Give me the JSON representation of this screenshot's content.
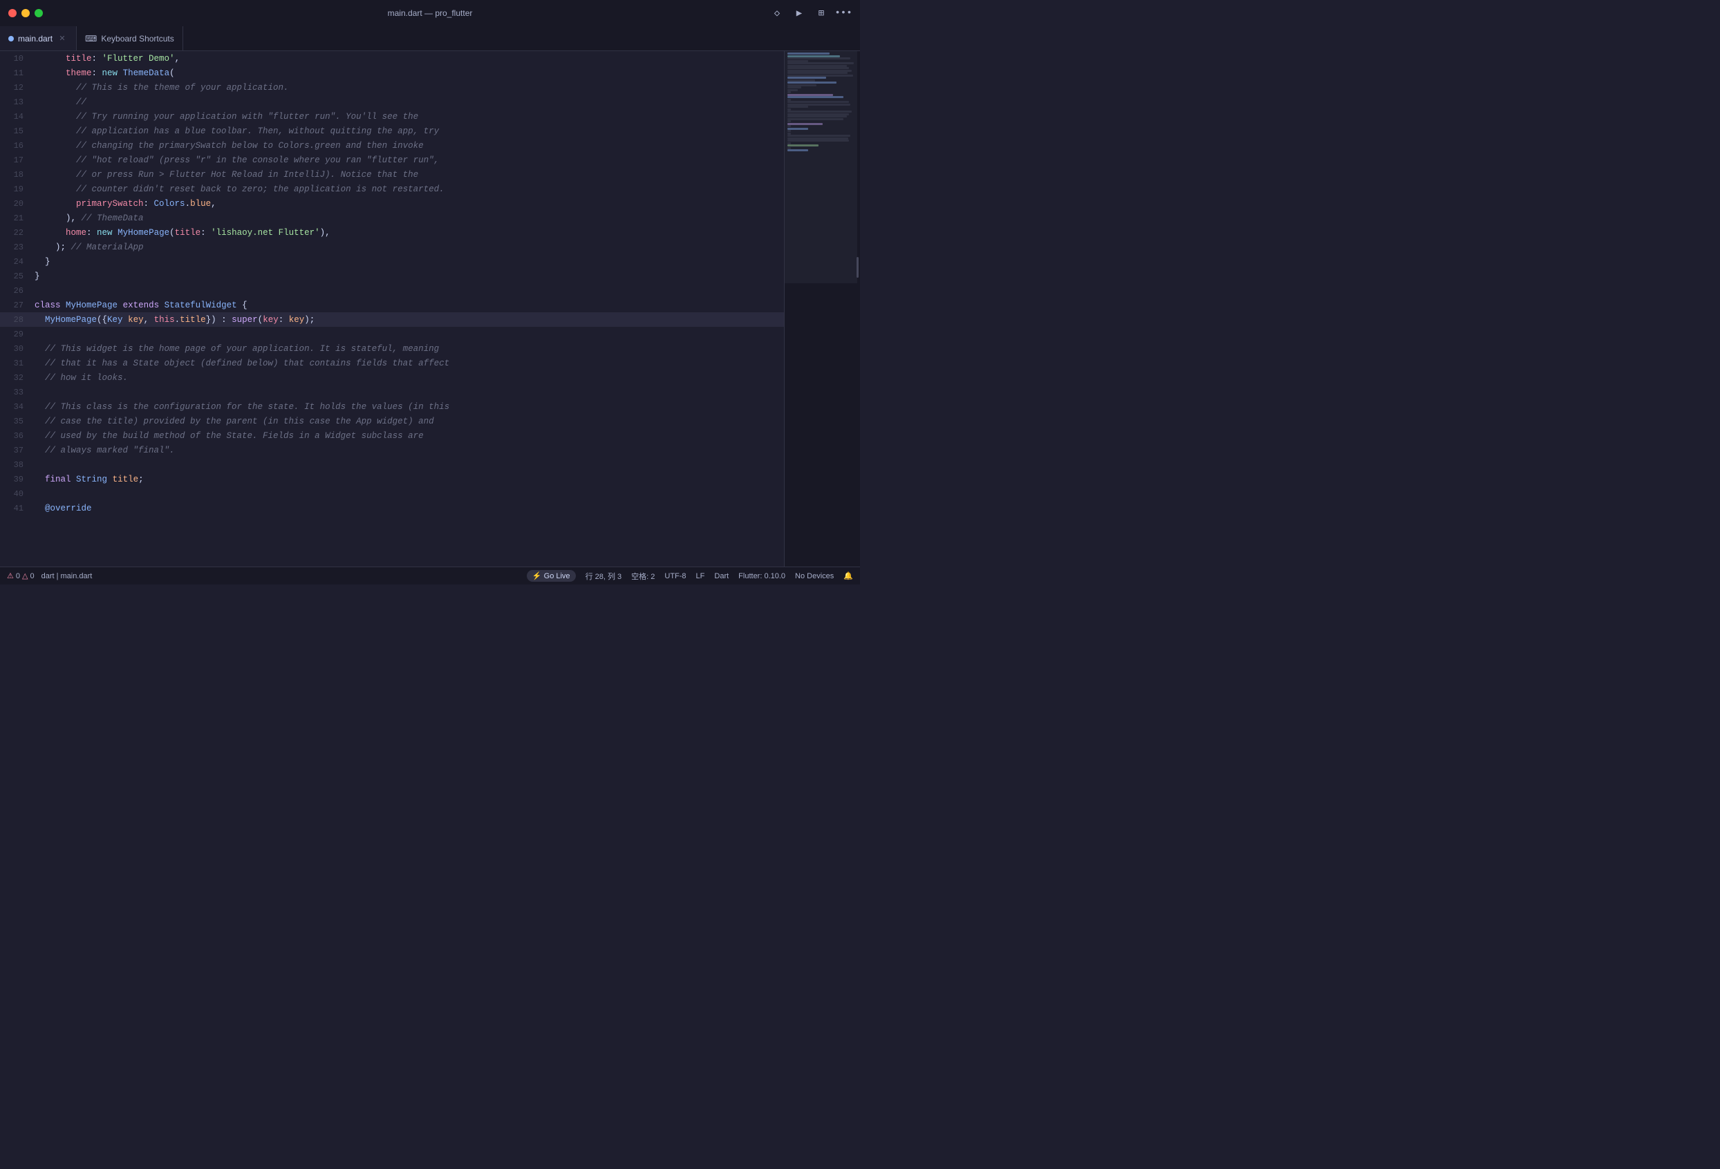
{
  "titleBar": {
    "title": "main.dart — pro_flutter",
    "trafficLights": [
      "red",
      "yellow",
      "green"
    ]
  },
  "tabs": [
    {
      "id": "main-dart",
      "label": "main.dart",
      "icon": "dart-icon",
      "active": true,
      "closable": true
    },
    {
      "id": "keyboard-shortcuts",
      "label": "Keyboard Shortcuts",
      "icon": "keyboard-icon",
      "active": false,
      "closable": false
    }
  ],
  "titleActions": [
    {
      "id": "source-control",
      "symbol": "◇",
      "label": "source control"
    },
    {
      "id": "run",
      "symbol": "▶",
      "label": "run"
    },
    {
      "id": "split-editor",
      "symbol": "⊡",
      "label": "split editor"
    },
    {
      "id": "more",
      "symbol": "···",
      "label": "more actions"
    }
  ],
  "codeLines": [
    {
      "num": 10,
      "highlight": false
    },
    {
      "num": 11,
      "highlight": false
    },
    {
      "num": 12,
      "highlight": false
    },
    {
      "num": 13,
      "highlight": false
    },
    {
      "num": 14,
      "highlight": false
    },
    {
      "num": 15,
      "highlight": false
    },
    {
      "num": 16,
      "highlight": false
    },
    {
      "num": 17,
      "highlight": false
    },
    {
      "num": 18,
      "highlight": false
    },
    {
      "num": 19,
      "highlight": false
    },
    {
      "num": 20,
      "highlight": false
    },
    {
      "num": 21,
      "highlight": false
    },
    {
      "num": 22,
      "highlight": false
    },
    {
      "num": 23,
      "highlight": false
    },
    {
      "num": 24,
      "highlight": false
    },
    {
      "num": 25,
      "highlight": false
    },
    {
      "num": 26,
      "highlight": false
    },
    {
      "num": 27,
      "highlight": false
    },
    {
      "num": 28,
      "highlight": true
    },
    {
      "num": 29,
      "highlight": false
    },
    {
      "num": 30,
      "highlight": false
    },
    {
      "num": 31,
      "highlight": false
    },
    {
      "num": 32,
      "highlight": false
    },
    {
      "num": 33,
      "highlight": false
    },
    {
      "num": 34,
      "highlight": false
    },
    {
      "num": 35,
      "highlight": false
    },
    {
      "num": 36,
      "highlight": false
    },
    {
      "num": 37,
      "highlight": false
    },
    {
      "num": 38,
      "highlight": false
    },
    {
      "num": 39,
      "highlight": false
    },
    {
      "num": 40,
      "highlight": false
    },
    {
      "num": 41,
      "highlight": false
    }
  ],
  "statusBar": {
    "errors": "0",
    "warnings": "0",
    "dartInfo": "dart |",
    "fileInfo": "main.dart",
    "goLive": "⚡ Go Live",
    "position": "行 28, 列 3",
    "spaces": "空格: 2",
    "encoding": "UTF-8",
    "lineEnding": "LF",
    "language": "Dart",
    "flutter": "Flutter: 0.10.0",
    "devices": "No Devices",
    "bellIcon": "🔔"
  }
}
